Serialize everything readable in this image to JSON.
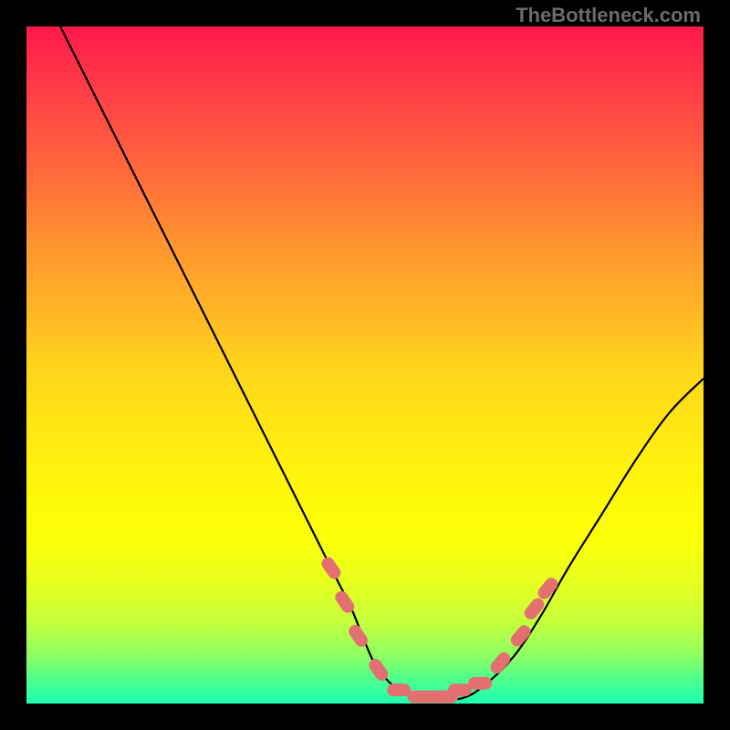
{
  "watermark": "TheBottleneck.com",
  "colors": {
    "background": "#000000",
    "curve_stroke": "#000000",
    "marker_fill": "#e27071",
    "marker_stroke": "#ce5f61"
  },
  "chart_data": {
    "type": "line",
    "title": "",
    "xlabel": "",
    "ylabel": "",
    "xlim": [
      0,
      100
    ],
    "ylim": [
      0,
      100
    ],
    "series": [
      {
        "name": "bottleneck-curve",
        "x": [
          5,
          10,
          15,
          20,
          25,
          30,
          35,
          40,
          45,
          48,
          50,
          52,
          55,
          58,
          60,
          62,
          65,
          68,
          72,
          76,
          80,
          85,
          90,
          95,
          100
        ],
        "y": [
          100,
          90,
          80,
          70,
          60,
          50,
          40,
          30,
          20,
          14,
          9,
          5,
          2,
          1,
          0.5,
          0.5,
          1,
          3,
          7,
          13,
          20,
          28,
          36,
          43,
          48
        ]
      }
    ],
    "markers": {
      "name": "highlighted-range",
      "x": [
        45,
        47,
        49,
        52,
        55,
        58,
        60,
        62,
        64,
        67,
        70,
        73,
        75,
        77
      ],
      "y": [
        20,
        15,
        10,
        5,
        2,
        1,
        1,
        1,
        2,
        3,
        6,
        10,
        14,
        17
      ]
    }
  }
}
